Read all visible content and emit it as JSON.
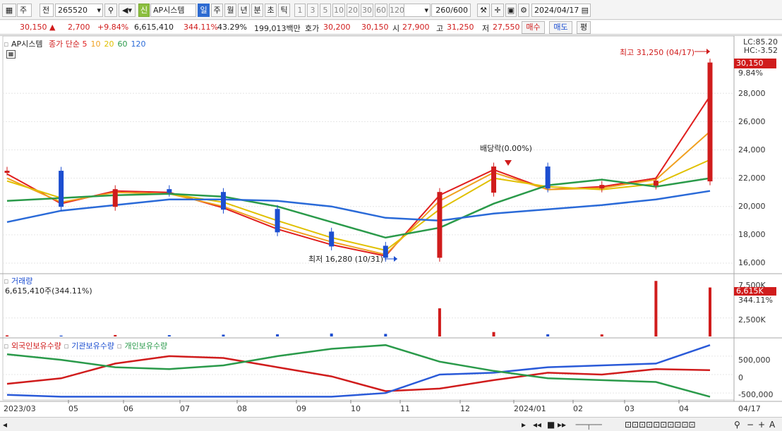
{
  "toolbar": {
    "type_select": "주",
    "exchange": "전",
    "code": "265520",
    "stock_name": "AP시스템",
    "new_badge": "신",
    "periods": [
      "일",
      "주",
      "월",
      "년",
      "분",
      "초",
      "틱"
    ],
    "intervals": [
      "1",
      "3",
      "5",
      "10",
      "20",
      "30",
      "60",
      "120"
    ],
    "count": "260",
    "count_max": "/600",
    "date": "2024/04/17"
  },
  "quote": {
    "price": "30,150",
    "change": "2,700",
    "change_pct": "+9.84%",
    "volume": "6,615,410",
    "volume_ratio": "344.11%",
    "turnover": "43.29%",
    "trade_value": "199,013백만",
    "ask_label": "호가",
    "ask": "30,200",
    "bid": "30,150",
    "open_label": "시",
    "open": "27,900",
    "high_label": "고",
    "high": "31,250",
    "low_label": "저",
    "low": "27,550",
    "buy_label": "매수",
    "sell_label": "매도",
    "avg_label": "평"
  },
  "price_panel": {
    "stock_legend": "AP시스템",
    "ma_prefix": "종가 단순",
    "ma_periods": [
      "5",
      "10",
      "20",
      "60",
      "120"
    ],
    "ma_colors": [
      "#e01e1e",
      "#f0a020",
      "#e0c000",
      "#2a9a4a",
      "#2a6ad8"
    ],
    "lc": "LC:85.20",
    "hc": "HC:-3.52",
    "current_price": "30,150",
    "current_pct": "9.84%",
    "high_annotation": "최고 31,250 (04/17)",
    "low_annotation": "최저 16,280 (10/31)",
    "dividend_annotation": "배당락(0.00%)",
    "y_ticks": [
      "28,000",
      "26,000",
      "24,000",
      "22,000",
      "20,000",
      "18,000",
      "16,000"
    ]
  },
  "volume_panel": {
    "title": "거래량",
    "value": "6,615,410주(344.11%)",
    "y_ticks": [
      "7,500K",
      "2,500K"
    ],
    "current": "6,615K",
    "current_pct": "344.11%"
  },
  "holding_panel": {
    "series": [
      "외국인보유수량",
      "기관보유수량",
      "개인보유수량"
    ],
    "colors": [
      "#d01c1c",
      "#2a5ad8",
      "#2a9a4a"
    ],
    "y_ticks": [
      "500,000",
      "0",
      "-500,000"
    ]
  },
  "x_axis": [
    "2023/03",
    "05",
    "06",
    "07",
    "08",
    "09",
    "10",
    "11",
    "12",
    "2024/01",
    "02",
    "03",
    "04",
    "04/17"
  ],
  "colors": {
    "up": "#d01c1c",
    "down": "#1c4ed0",
    "accent": "#2e6bd1"
  },
  "chart_data": [
    {
      "type": "line",
      "title": "AP시스템",
      "x": [
        "2023/03",
        "05",
        "06",
        "07",
        "08",
        "09",
        "10",
        "11",
        "12",
        "2024/01",
        "02",
        "03",
        "04",
        "04/17"
      ],
      "series": [
        {
          "name": "종가",
          "values": [
            22500,
            20000,
            21200,
            21000,
            19800,
            18200,
            17200,
            16400,
            21000,
            22800,
            21300,
            21500,
            21800,
            30150
          ]
        },
        {
          "name": "5",
          "values": [
            22300,
            20200,
            21100,
            21000,
            19900,
            18400,
            17300,
            16500,
            20800,
            22600,
            21200,
            21400,
            22000,
            27800
          ]
        },
        {
          "name": "10",
          "values": [
            22000,
            20300,
            21000,
            20900,
            20000,
            18600,
            17500,
            16600,
            20400,
            22400,
            21200,
            21300,
            21900,
            25300
          ]
        },
        {
          "name": "20",
          "values": [
            21800,
            20600,
            20800,
            20900,
            20300,
            19000,
            17800,
            16900,
            19800,
            22000,
            21400,
            21200,
            21600,
            23300
          ]
        },
        {
          "name": "60",
          "values": [
            20400,
            20600,
            20800,
            20900,
            20700,
            20000,
            18900,
            17800,
            18500,
            20200,
            21500,
            21900,
            21400,
            22000
          ]
        },
        {
          "name": "120",
          "values": [
            18900,
            19700,
            20100,
            20500,
            20500,
            20400,
            20000,
            19200,
            19000,
            19500,
            19800,
            20100,
            20500,
            21100
          ]
        }
      ],
      "ylim": [
        15500,
        31800
      ],
      "annotations": [
        "최고 31,250 (04/17)",
        "최저 16,280 (10/31)",
        "배당락(0.00%)"
      ]
    },
    {
      "type": "bar",
      "title": "거래량",
      "series": [
        {
          "name": "거래량",
          "values": [
            150,
            120,
            200,
            180,
            250,
            300,
            400,
            350,
            3800,
            600,
            300,
            280,
            7500,
            6615
          ]
        }
      ],
      "x": [
        "2023/03",
        "05",
        "06",
        "07",
        "08",
        "09",
        "10",
        "11",
        "12",
        "2024/01",
        "02",
        "03",
        "04",
        "04/17"
      ],
      "ylabel": "K"
    },
    {
      "type": "line",
      "title": "보유수량",
      "x": [
        "2023/03",
        "05",
        "06",
        "07",
        "08",
        "09",
        "10",
        "11",
        "12",
        "2024/01",
        "02",
        "03",
        "04",
        "04/17"
      ],
      "series": [
        {
          "name": "외국인보유수량",
          "values": [
            -250000,
            -100000,
            300000,
            500000,
            450000,
            200000,
            -50000,
            -450000,
            -380000,
            -150000,
            50000,
            0,
            150000,
            120000
          ]
        },
        {
          "name": "기관보유수량",
          "values": [
            -550000,
            -600000,
            -600000,
            -600000,
            -600000,
            -600000,
            -600000,
            -500000,
            0,
            50000,
            200000,
            250000,
            300000,
            800000
          ]
        },
        {
          "name": "개인보유수량",
          "values": [
            550000,
            400000,
            200000,
            150000,
            250000,
            500000,
            700000,
            800000,
            350000,
            100000,
            -100000,
            -150000,
            -200000,
            -600000
          ]
        }
      ],
      "ylim": [
        -650000,
        900000
      ]
    }
  ]
}
